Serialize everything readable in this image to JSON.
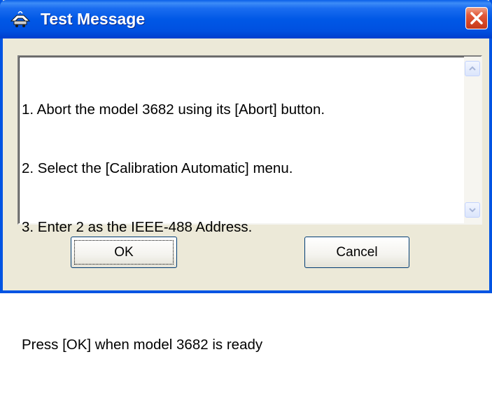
{
  "window": {
    "title": "Test Message",
    "app_icon": "signal-generator-icon",
    "close_icon": "close-icon"
  },
  "message": {
    "lines": [
      "1. Abort the model 3682 using its [Abort] button.",
      "2. Select the [Calibration Automatic] menu.",
      "3. Enter 2 as the IEEE-488 Address.",
      "",
      "Press [OK] when model 3682 is ready"
    ]
  },
  "buttons": {
    "ok_label": "OK",
    "cancel_label": "Cancel"
  },
  "colors": {
    "titlebar": "#0058e6",
    "window_bg": "#ece9d8",
    "close_button": "#d44626",
    "button_border": "#003c74"
  }
}
